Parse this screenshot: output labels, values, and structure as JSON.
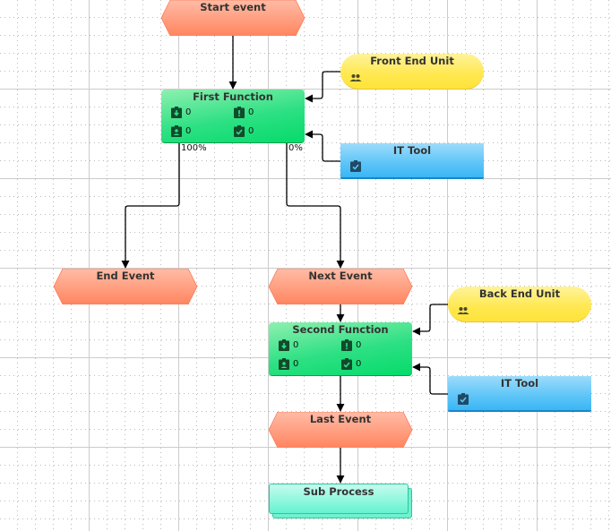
{
  "diagram": {
    "events": [
      {
        "id": "start",
        "label": "Start event"
      },
      {
        "id": "end",
        "label": "End Event"
      },
      {
        "id": "next",
        "label": "Next Event"
      },
      {
        "id": "last",
        "label": "Last Event"
      }
    ],
    "functions": [
      {
        "id": "first",
        "label": "First Function",
        "counts": {
          "input": "0",
          "risk": "0",
          "person": "0",
          "task": "0"
        }
      },
      {
        "id": "second",
        "label": "Second Function",
        "counts": {
          "input": "0",
          "risk": "0",
          "person": "0",
          "task": "0"
        }
      }
    ],
    "org_units": [
      {
        "id": "front",
        "label": "Front End Unit",
        "icon": "group-icon"
      },
      {
        "id": "back",
        "label": "Back End Unit",
        "icon": "group-icon"
      }
    ],
    "systems": [
      {
        "id": "it1",
        "label": "IT Tool",
        "icon": "clipboard-check-icon"
      },
      {
        "id": "it2",
        "label": "IT Tool",
        "icon": "clipboard-check-icon"
      }
    ],
    "subprocess": {
      "label": "Sub Process"
    },
    "branch_labels": {
      "left": "100%",
      "right": "0%"
    }
  },
  "colors": {
    "event": "#ff8a6a",
    "function": "#10dd72",
    "org_unit": "#ffe84a",
    "system": "#4abcf5",
    "subprocess": "#7ef5d6",
    "grid_major": "#cccccc",
    "grid_minor": "#bbbbbb"
  }
}
